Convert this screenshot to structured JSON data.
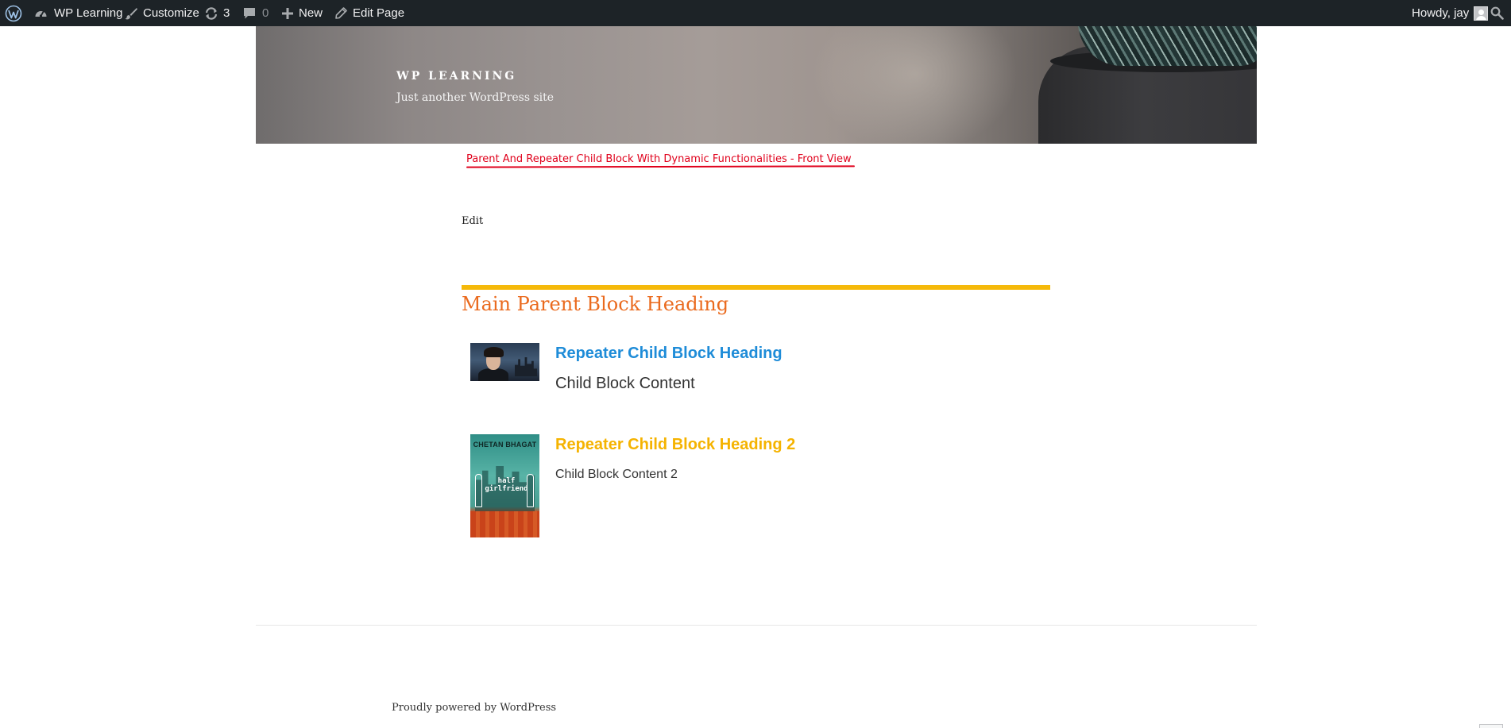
{
  "admin_bar": {
    "site_name": "WP Learning",
    "customize": "Customize",
    "updates_count": "3",
    "comments_count": "0",
    "new_label": "New",
    "edit_page": "Edit Page",
    "howdy": "Howdy, jay",
    "icons": [
      "wordpress-logo-icon",
      "dashboard-icon",
      "brush-icon",
      "updates-icon",
      "comment-icon",
      "plus-icon",
      "pencil-icon",
      "avatar",
      "search-icon"
    ]
  },
  "header": {
    "site_title": "WP LEARNING",
    "tagline": "Just another WordPress site"
  },
  "content": {
    "annotation": "Parent And Repeater Child Block With Dynamic Functionalities - Front View",
    "annotation_color": "#e0001b",
    "edit_link": "Edit",
    "parent_block": {
      "heading": "Main Parent Block Heading",
      "heading_color": "#ea6a1e",
      "rule_color": "#f5b90a",
      "children": [
        {
          "heading": "Repeater Child Block Heading",
          "heading_color": "#1e8cd8",
          "content": "Child Block Content",
          "image": "movie-still-thumbnail"
        },
        {
          "heading": "Repeater Child Block Heading 2",
          "heading_color": "#f5b300",
          "content": "Child Block Content 2",
          "image": "book-cover-thumbnail",
          "image_text": {
            "author": "CHETAN BHAGAT",
            "title": "half girlfriend"
          }
        }
      ]
    }
  },
  "footer": {
    "credit": "Proudly powered by WordPress"
  }
}
